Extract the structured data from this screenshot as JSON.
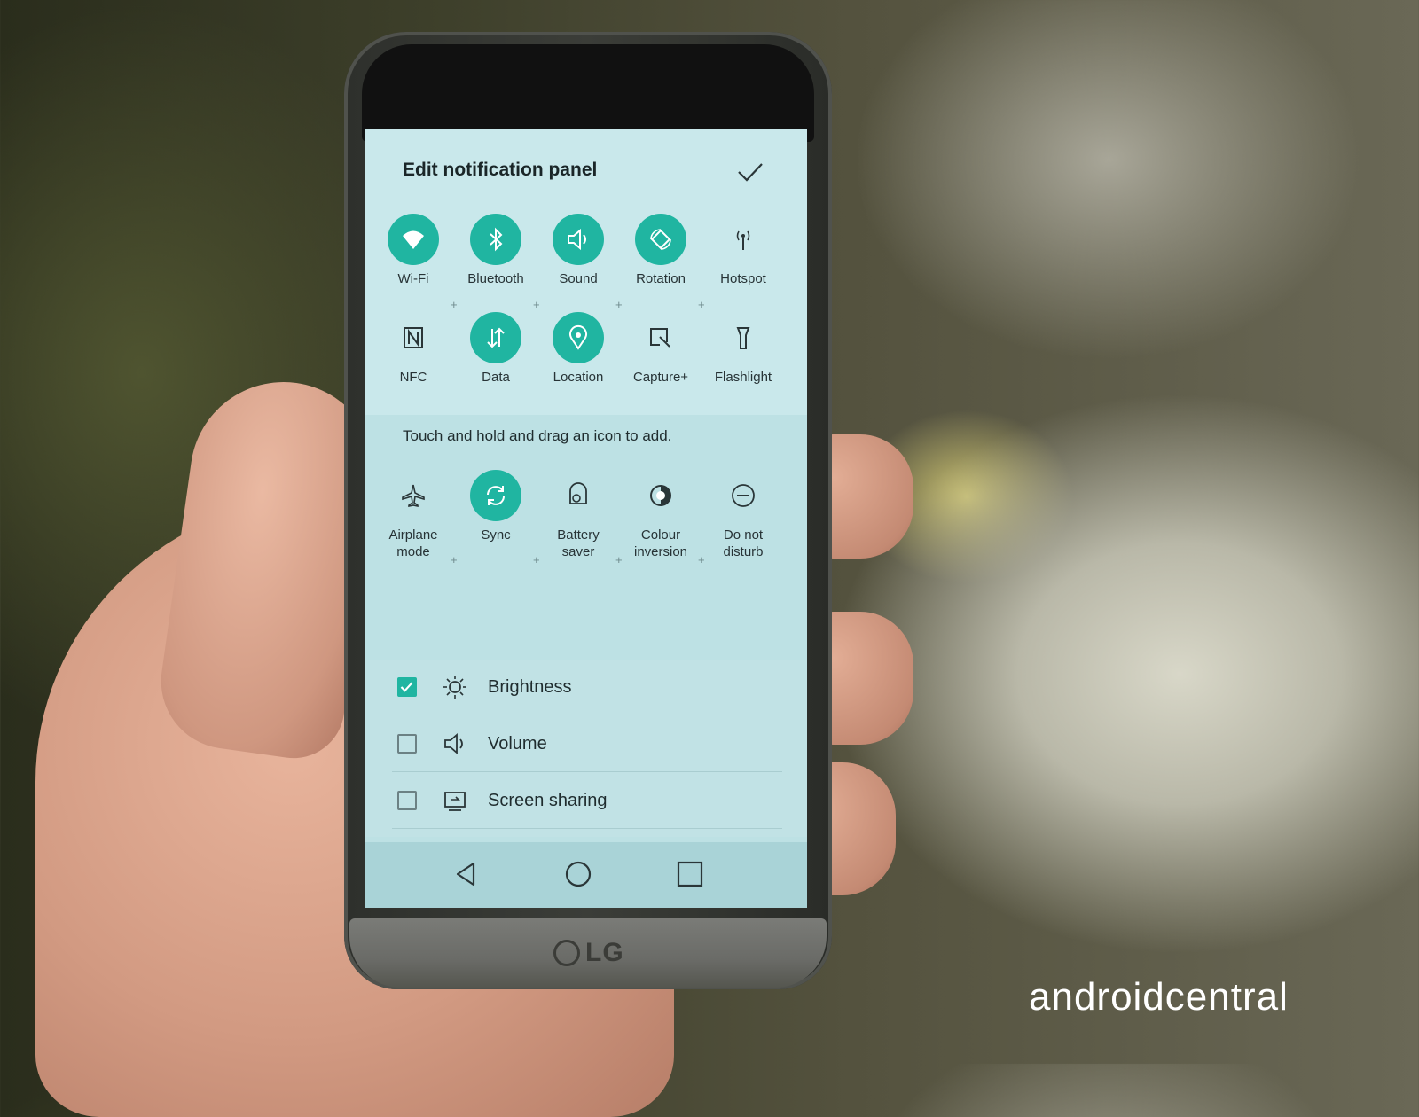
{
  "panel": {
    "title": "Edit notification panel",
    "confirm_icon": "checkmark-icon"
  },
  "active_tiles": [
    {
      "label": "Wi-Fi",
      "icon": "wifi-icon",
      "on": true
    },
    {
      "label": "Bluetooth",
      "icon": "bluetooth-icon",
      "on": true
    },
    {
      "label": "Sound",
      "icon": "sound-icon",
      "on": true
    },
    {
      "label": "Rotation",
      "icon": "rotation-icon",
      "on": true
    },
    {
      "label": "Hotspot",
      "icon": "hotspot-icon",
      "on": false
    },
    {
      "label": "NFC",
      "icon": "nfc-icon",
      "on": false
    },
    {
      "label": "Data",
      "icon": "data-icon",
      "on": true
    },
    {
      "label": "Location",
      "icon": "location-icon",
      "on": true
    },
    {
      "label": "Capture+",
      "icon": "capture-plus-icon",
      "on": false
    },
    {
      "label": "Flashlight",
      "icon": "flashlight-icon",
      "on": false
    }
  ],
  "hint": "Touch and hold and drag an icon to add.",
  "available_tiles": [
    {
      "label": "Airplane mode",
      "line1": "Airplane",
      "line2": "mode",
      "icon": "airplane-icon",
      "on": false
    },
    {
      "label": "Sync",
      "line1": "Sync",
      "line2": "",
      "icon": "sync-icon",
      "on": true
    },
    {
      "label": "Battery saver",
      "line1": "Battery",
      "line2": "saver",
      "icon": "battery-saver-icon",
      "on": false
    },
    {
      "label": "Colour inversion",
      "line1": "Colour",
      "line2": "inversion",
      "icon": "colour-inversion-icon",
      "on": false
    },
    {
      "label": "Do not disturb",
      "line1": "Do not",
      "line2": "disturb",
      "icon": "do-not-disturb-icon",
      "on": false
    }
  ],
  "sliders": [
    {
      "label": "Brightness",
      "icon": "brightness-icon",
      "checked": true
    },
    {
      "label": "Volume",
      "icon": "volume-icon",
      "checked": false
    },
    {
      "label": "Screen sharing",
      "icon": "screen-sharing-icon",
      "checked": false
    }
  ],
  "navbar": {
    "back_icon": "back-icon",
    "home_icon": "home-icon",
    "recents_icon": "recents-icon"
  },
  "device": {
    "brand": "LG"
  },
  "watermark": "androidcentral",
  "colors": {
    "accent": "#20b5a1",
    "screen_bg": "#c9e8eb"
  }
}
